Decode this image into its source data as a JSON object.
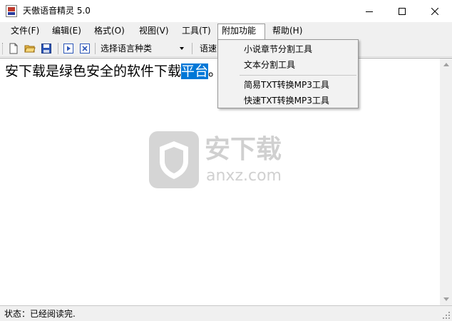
{
  "window": {
    "title": "天傲语音精灵 5.0",
    "controls": {
      "minimize": "minimize-icon",
      "maximize": "maximize-icon",
      "close": "close-icon"
    }
  },
  "menubar": {
    "items": [
      {
        "label": "文件(F)"
      },
      {
        "label": "编辑(E)"
      },
      {
        "label": "格式(O)"
      },
      {
        "label": "视图(V)"
      },
      {
        "label": "工具(T)"
      },
      {
        "label": "附加功能",
        "active": true
      },
      {
        "label": "帮助(H)"
      }
    ]
  },
  "toolbar": {
    "buttons": [
      "new-file-icon",
      "open-folder-icon",
      "save-icon",
      "play-icon",
      "stop-icon"
    ],
    "language_select": "选择语言种类",
    "speed_label": "语速"
  },
  "editor": {
    "text_plain": "安下载是绿色安全的软件下载",
    "text_selected": "平台",
    "text_tail": "。"
  },
  "dropdown": {
    "items": [
      {
        "label": "小说章节分割工具"
      },
      {
        "label": "文本分割工具"
      },
      {
        "label": "简易TXT转换MP3工具"
      },
      {
        "label": "快速TXT转换MP3工具"
      }
    ]
  },
  "statusbar": {
    "text": "状态：已经阅读完."
  },
  "watermark": {
    "text_cn": "安下载",
    "text_en": "anxz.com"
  },
  "colors": {
    "selection": "#0078d7",
    "menubar_bg": "#f0f0f0",
    "accent_red": "#c0392b"
  }
}
